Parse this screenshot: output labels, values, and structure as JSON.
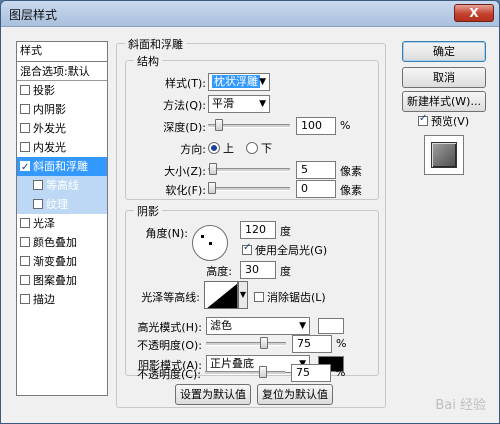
{
  "window": {
    "title": "图层样式",
    "close_label": "X"
  },
  "styles_panel": {
    "header": "样式",
    "items": [
      {
        "label": "混合选项:默认",
        "checkbox": false,
        "checked": false,
        "state": "blend"
      },
      {
        "label": "投影",
        "checkbox": true,
        "checked": false,
        "state": ""
      },
      {
        "label": "内阴影",
        "checkbox": true,
        "checked": false,
        "state": ""
      },
      {
        "label": "外发光",
        "checkbox": true,
        "checked": false,
        "state": ""
      },
      {
        "label": "内发光",
        "checkbox": true,
        "checked": false,
        "state": ""
      },
      {
        "label": "斜面和浮雕",
        "checkbox": true,
        "checked": true,
        "state": "selected"
      },
      {
        "label": "等高线",
        "checkbox": true,
        "checked": false,
        "state": "subsel"
      },
      {
        "label": "纹理",
        "checkbox": true,
        "checked": false,
        "state": "subsel"
      },
      {
        "label": "光泽",
        "checkbox": true,
        "checked": false,
        "state": ""
      },
      {
        "label": "颜色叠加",
        "checkbox": true,
        "checked": false,
        "state": ""
      },
      {
        "label": "渐变叠加",
        "checkbox": true,
        "checked": false,
        "state": ""
      },
      {
        "label": "图案叠加",
        "checkbox": true,
        "checked": false,
        "state": ""
      },
      {
        "label": "描边",
        "checkbox": true,
        "checked": false,
        "state": ""
      }
    ]
  },
  "bevel": {
    "group_title": "斜面和浮雕",
    "structure": {
      "title": "结构",
      "style_label": "样式(T):",
      "style_value": "枕状浮雕",
      "technique_label": "方法(Q):",
      "technique_value": "平滑",
      "depth_label": "深度(D):",
      "depth_value": "100",
      "depth_unit": "%",
      "depth_level": 0.1,
      "direction_label": "方向:",
      "direction_up": "上",
      "direction_down": "下",
      "size_label": "大小(Z):",
      "size_value": "5",
      "size_unit": "像素",
      "size_level": 0.02,
      "soften_label": "软化(F):",
      "soften_value": "0",
      "soften_unit": "像素",
      "soften_level": 0.0
    },
    "shading": {
      "title": "阴影",
      "angle_label": "角度(N):",
      "angle_value": "120",
      "angle_unit": "度",
      "global_light_label": "使用全局光(G)",
      "global_light_checked": true,
      "altitude_label": "高度:",
      "altitude_value": "30",
      "altitude_unit": "度",
      "gloss_label": "光泽等高线:",
      "antialias_label": "消除锯齿(L)",
      "antialias_checked": false,
      "highlight_label": "高光模式(H):",
      "highlight_value": "滤色",
      "highlight_color": "#ffffff",
      "highlight_opacity_label": "不透明度(O):",
      "highlight_opacity_value": "75",
      "highlight_opacity_unit": "%",
      "highlight_opacity_level": 0.75,
      "shadow_label": "阴影模式(A):",
      "shadow_value": "正片叠底",
      "shadow_color": "#000000",
      "shadow_opacity_label": "不透明度(C):",
      "shadow_opacity_value": "75",
      "shadow_opacity_unit": "%",
      "shadow_opacity_level": 0.75
    },
    "make_default": "设置为默认值",
    "reset_default": "复位为默认值"
  },
  "right": {
    "ok": "确定",
    "cancel": "取消",
    "new_style": "新建样式(W)...",
    "preview_label": "预览(V)",
    "preview_checked": true
  },
  "watermark": "Bai 经验"
}
